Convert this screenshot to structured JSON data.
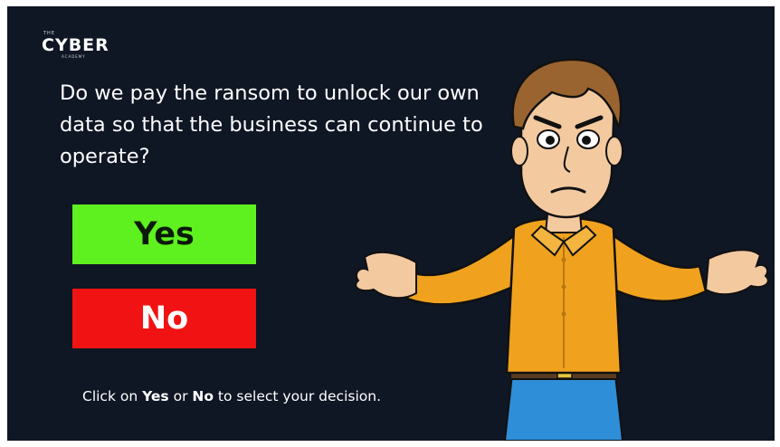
{
  "brand": {
    "logo_top": "THE",
    "logo_main": "CYBER",
    "logo_bottom": "ACADEMY"
  },
  "question": "Do we pay the ransom to unlock our own data so that the business can continue to operate?",
  "options": {
    "yes_label": "Yes",
    "no_label": "No"
  },
  "hint": {
    "prefix": "Click on ",
    "yes": "Yes",
    "middle": " or ",
    "no": "No",
    "suffix": " to select your decision."
  },
  "colors": {
    "background": "#0f1624",
    "yes": "#5ef01f",
    "no": "#f11313",
    "shirt": "#f0a21e"
  },
  "illustration": "shrugging-man"
}
